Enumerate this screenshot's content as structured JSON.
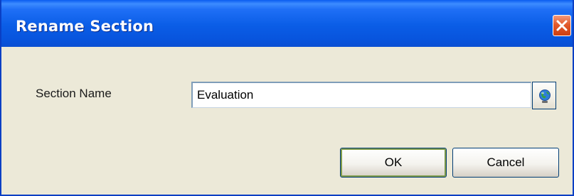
{
  "window": {
    "title": "Rename Section",
    "close_icon": "close-icon"
  },
  "form": {
    "section_name_label": "Section Name",
    "section_name_value": "Evaluation",
    "globe_icon": "globe-icon"
  },
  "buttons": {
    "ok_label": "OK",
    "cancel_label": "Cancel"
  },
  "colors": {
    "titlebar": "#0a5ce6",
    "close_button": "#e25a2c",
    "dialog_background": "#ece9d8"
  }
}
